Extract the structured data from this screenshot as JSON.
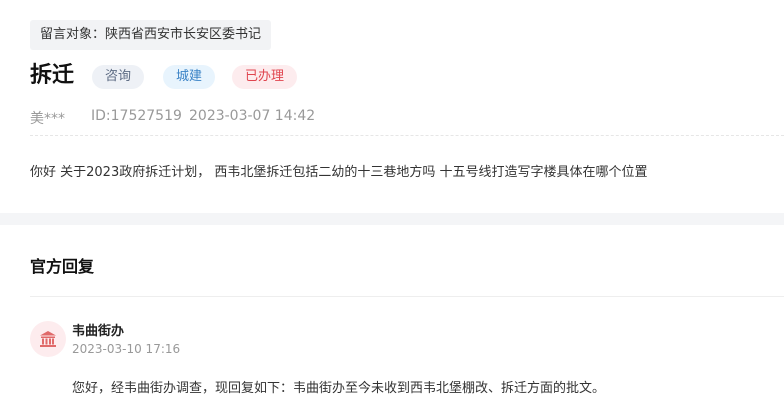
{
  "message": {
    "target": "留言对象：陕西省西安市长安区委书记",
    "title": "拆迁",
    "tags": [
      "咨询",
      "城建",
      "已办理"
    ],
    "tag_colors": {
      "consult": "#5e6c84",
      "city": "#3b83c6",
      "done": "#e0454f"
    },
    "user": "美***",
    "id_text": "ID:17527519",
    "datetime": "2023-03-07 14:42",
    "content": "你好 关于2023政府拆迁计划， 西韦北堡拆迁包括二幼的十三巷地方吗 十五号线打造写字楼具体在哪个位置"
  },
  "reply": {
    "heading": "官方回复",
    "replier": "韦曲街办",
    "datetime": "2023-03-10 17:16",
    "content": "您好，经韦曲街办调查，现回复如下：韦曲街办至今未收到西韦北堡棚改、拆迁方面的批文。",
    "avatar_icon": "government-building-icon"
  }
}
